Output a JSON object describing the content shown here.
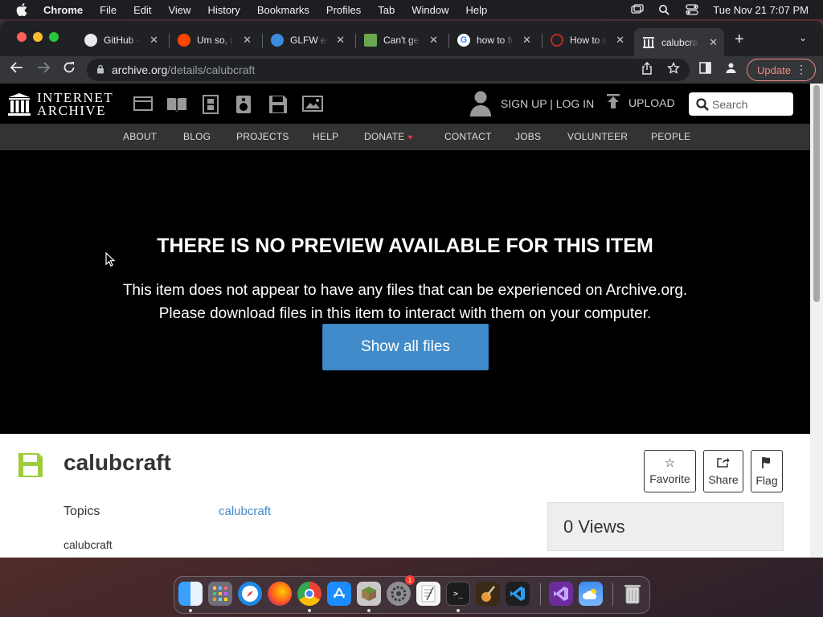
{
  "menubar": {
    "apple": "",
    "items": [
      "Chrome",
      "File",
      "Edit",
      "View",
      "History",
      "Bookmarks",
      "Profiles",
      "Tab",
      "Window",
      "Help"
    ],
    "datetime": "Tue Nov 21  7:07 PM"
  },
  "tabs": [
    {
      "title": "GitHub -",
      "icon": "github-icon",
      "color": "#e8eaed"
    },
    {
      "title": "Um so, m",
      "icon": "reddit-icon",
      "color": "#ff4500"
    },
    {
      "title": "GLFW err",
      "icon": "firefox-globe-icon",
      "color": "#3d8be0"
    },
    {
      "title": "Can't get",
      "icon": "minecraft-icon",
      "color": "#6aa84f"
    },
    {
      "title": "how to fu",
      "icon": "google-icon",
      "color": "#4285f4"
    },
    {
      "title": "How to s",
      "icon": "quora-icon",
      "color": "#b92b27"
    },
    {
      "title": "calubcraf",
      "icon": "internet-archive-icon",
      "color": "#e8eaed",
      "active": true
    }
  ],
  "address": {
    "host": "archive.org",
    "path": "/details/calubcraft"
  },
  "update_label": "Update",
  "ia": {
    "logo_line1": "INTERNET",
    "logo_line2": "ARCHIVE",
    "signup": "SIGN UP | LOG IN",
    "upload": "UPLOAD",
    "search_placeholder": "Search",
    "nav": [
      "ABOUT",
      "BLOG",
      "PROJECTS",
      "HELP",
      "DONATE",
      "CONTACT",
      "JOBS",
      "VOLUNTEER",
      "PEOPLE"
    ]
  },
  "preview": {
    "heading": "THERE IS NO PREVIEW AVAILABLE FOR THIS ITEM",
    "line1": "This item does not appear to have any files that can be experienced on Archive.org.",
    "line2": "Please download files in this item to interact with them on your computer.",
    "button": "Show all files"
  },
  "item": {
    "title": "calubcraft",
    "actions": {
      "favorite": "Favorite",
      "share": "Share",
      "flag": "Flag"
    },
    "topics_label": "Topics",
    "topics_value": "calubcraft",
    "description": "calubcraft",
    "views": "0 Views"
  },
  "dock": {
    "apps": [
      "Finder",
      "Launchpad",
      "Safari",
      "Firefox",
      "Chrome",
      "App Store",
      "Minecraft",
      "System Settings",
      "TextEdit",
      "Terminal",
      "GarageBand",
      "VS Code",
      "Visual Studio",
      "Weather",
      "Trash"
    ],
    "badge": "1"
  }
}
